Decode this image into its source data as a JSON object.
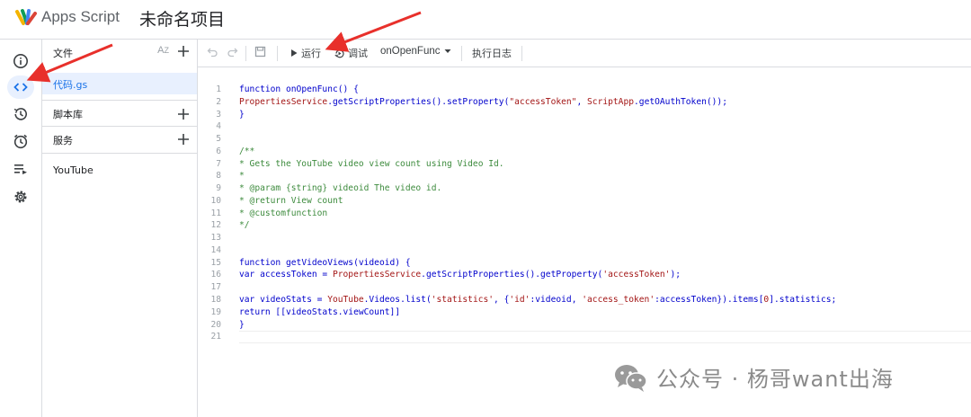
{
  "header": {
    "app_name": "Apps Script",
    "project_name": "未命名项目"
  },
  "rail": {
    "items": [
      {
        "icon": "info-icon"
      },
      {
        "icon": "code-icon",
        "active": true
      },
      {
        "icon": "history-icon"
      },
      {
        "icon": "clock-icon"
      },
      {
        "icon": "executions-icon"
      },
      {
        "icon": "gear-icon"
      }
    ]
  },
  "files_panel": {
    "files_label": "文件",
    "sort_label": "A͢Z",
    "active_file": "代码.gs",
    "libraries_label": "脚本库",
    "services_label": "服务",
    "service_item": "YouTube"
  },
  "toolbar": {
    "run_label": "运行",
    "debug_label": "调试",
    "function_select": "onOpenFunc",
    "log_label": "执行日志"
  },
  "editor": {
    "lines": [
      {
        "n": "1",
        "t": "function onOpenFunc() {"
      },
      {
        "n": "2",
        "t": "PropertiesService.getScriptProperties().setProperty(\"accessToken\", ScriptApp.getOAuthToken());"
      },
      {
        "n": "3",
        "t": "}"
      },
      {
        "n": "4",
        "t": ""
      },
      {
        "n": "5",
        "t": ""
      },
      {
        "n": "6",
        "t": "/**"
      },
      {
        "n": "7",
        "t": "* Gets the YouTube video view count using Video Id."
      },
      {
        "n": "8",
        "t": "*"
      },
      {
        "n": "9",
        "t": "* @param {string} videoid The video id."
      },
      {
        "n": "10",
        "t": "* @return View count"
      },
      {
        "n": "11",
        "t": "* @customfunction"
      },
      {
        "n": "12",
        "t": "*/"
      },
      {
        "n": "13",
        "t": ""
      },
      {
        "n": "14",
        "t": ""
      },
      {
        "n": "15",
        "t": "function getVideoViews(videoid) {"
      },
      {
        "n": "16",
        "t": "var accessToken = PropertiesService.getScriptProperties().getProperty('accessToken');"
      },
      {
        "n": "17",
        "t": ""
      },
      {
        "n": "18",
        "t": "var videoStats = YouTube.Videos.list('statistics', {'id':videoid, 'access_token':accessToken}).items[0].statistics;"
      },
      {
        "n": "19",
        "t": "return [[videoStats.viewCount]]"
      },
      {
        "n": "20",
        "t": "}"
      },
      {
        "n": "21",
        "t": ""
      }
    ]
  },
  "watermark": {
    "text": "公众号 · 杨哥want出海"
  },
  "colors": {
    "accent": "#1a73e8",
    "active_bg": "#e8f0fe",
    "arrow": "#e8302b"
  }
}
